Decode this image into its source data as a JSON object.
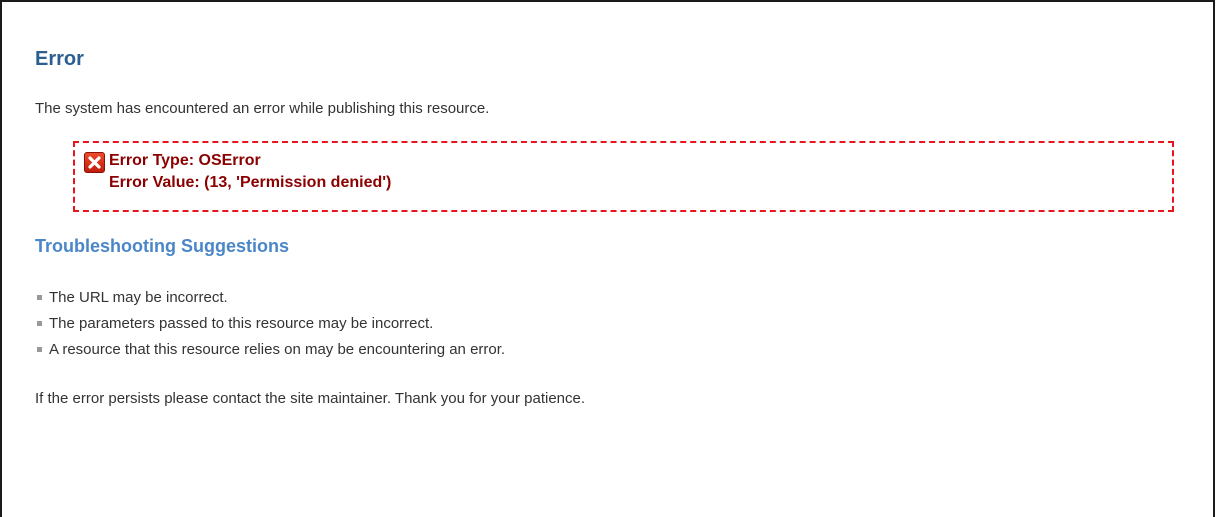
{
  "page": {
    "title": "Error",
    "intro": "The system has encountered an error while publishing this resource."
  },
  "error": {
    "icon": "error-x-icon",
    "type_line": "Error Type: OSError",
    "value_line": "Error Value: (13, 'Permission denied')",
    "border_color": "#e8141e",
    "text_color": "#8b0000"
  },
  "troubleshooting": {
    "heading": "Troubleshooting Suggestions",
    "items": [
      "The URL may be incorrect.",
      "The parameters passed to this resource may be incorrect.",
      "A resource that this resource relies on may be encountering an error."
    ]
  },
  "footer": {
    "text": "If the error persists please contact the site maintainer. Thank you for your patience."
  },
  "colors": {
    "heading": "#2c5f8f",
    "subheading": "#4a86c8",
    "body_text": "#333333"
  }
}
